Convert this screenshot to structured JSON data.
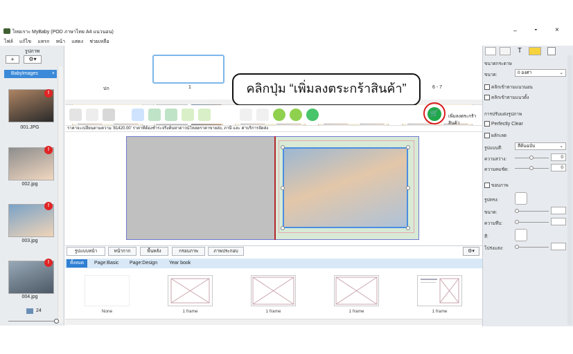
{
  "app": {
    "title": "ไทยเราะ MyBaby (POD ภาษาไทย A4 แนวนอน)"
  },
  "menu": [
    "ไฟล์",
    "แก้ไข",
    "แทรก",
    "หน้า",
    "แสดง",
    "ช่วยเหลือ"
  ],
  "window": {
    "minimize": "–",
    "maximize": "╸",
    "close": "×"
  },
  "left": {
    "header": "รูปภาพ",
    "folder": "BabyImages",
    "images": [
      "001.JPG",
      "002.jpg",
      "003.jpg",
      "004.jpg"
    ],
    "badge": "!",
    "count": "24"
  },
  "pages": {
    "p1": "ปก",
    "p2": "1",
    "p3": "6 - 7"
  },
  "callout": "คลิกปุ่ม “เพิ่มลงตระกร้าสินค้า”",
  "toolbar": {
    "cart_label": "เพิ่มลงตระกร้าสินค้า"
  },
  "pricebar": "ราคาจะเปลี่ยนตามความ '81420.00' ราคาที่ต้องชำระจริงค้นหาดาวน์โหลดราคาขายส่ง, ภาษี และ ค่าบริการจัดส่ง",
  "tabs": [
    "รูปแบบหน้า",
    "หน้ากาก",
    "พื้นหลัง",
    "กรอบภาพ",
    "ภาพประกอบ"
  ],
  "subtabs": [
    "ทั้งหมด",
    "Page:Basic",
    "Page:Design",
    "Year book"
  ],
  "layouts": [
    "None",
    "1 frame",
    "1 frame",
    "1 frame",
    "1 frame"
  ],
  "right": {
    "section1": "ขนาดกระดาษ",
    "zoom_label": "ขนาด:",
    "zoom_value": "0 องศา",
    "cb1": "คลิกเข้าตามแนวนอน",
    "cb2": "คลิกเข้าตามแนวตั้ง",
    "section2": "การปรับแต่งรูปภาพ",
    "perfectly_clear": "Perfectly Clear",
    "sepia": "ผลักเลต",
    "effect_label": "รูปแบบสี:",
    "effect_value": "สีต้นฉบับ",
    "brightness_label": "ความสว่าง:",
    "brightness_value": "0",
    "contrast_label": "ความคมชัด:",
    "contrast_value": "0",
    "border_cb": "ขอบภาพ",
    "frame_label": "รูปทรง:",
    "size_label": "ขนาด:",
    "opacity_label": "ความทึบ:",
    "color_label": "สี:",
    "shadow_label": "โปร่งแสง:"
  },
  "colors": {
    "accent": "#2f7fd3",
    "cart": "#1fa84a",
    "badge": "#e02424",
    "highlight": "#d81b1b"
  }
}
